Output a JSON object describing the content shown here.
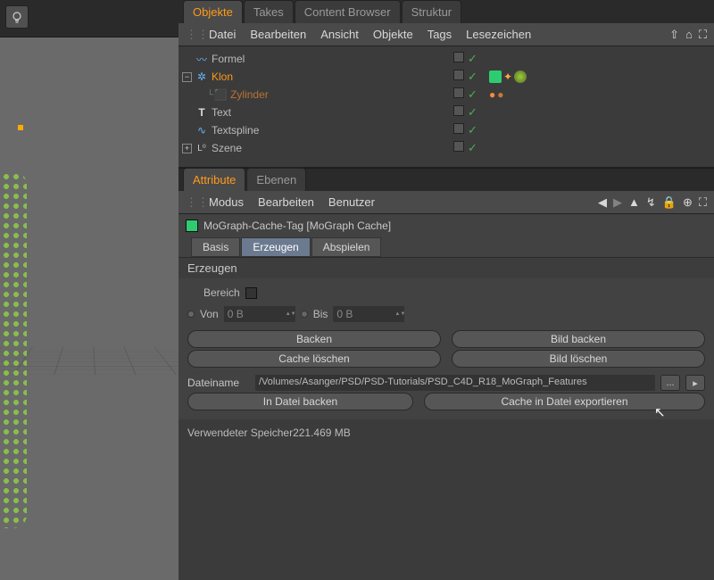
{
  "top_tabs": {
    "objekte": "Objekte",
    "takes": "Takes",
    "content": "Content Browser",
    "struktur": "Struktur"
  },
  "top_menu": {
    "datei": "Datei",
    "bearbeiten": "Bearbeiten",
    "ansicht": "Ansicht",
    "objekte": "Objekte",
    "tags": "Tags",
    "lesezeichen": "Lesezeichen"
  },
  "tree": {
    "formel": "Formel",
    "klon": "Klon",
    "zylinder": "Zylinder",
    "text": "Text",
    "textspline": "Textspline",
    "szene": "Szene"
  },
  "attr_tabs": {
    "attribute": "Attribute",
    "ebenen": "Ebenen"
  },
  "attr_menu": {
    "modus": "Modus",
    "bearbeiten": "Bearbeiten",
    "benutzer": "Benutzer"
  },
  "tag_title": "MoGraph-Cache-Tag [MoGraph Cache]",
  "subtabs": {
    "basis": "Basis",
    "erzeugen": "Erzeugen",
    "abspielen": "Abspielen"
  },
  "section": "Erzeugen",
  "fields": {
    "bereich": "Bereich",
    "von": "Von",
    "von_val": "0 B",
    "bis": "Bis",
    "bis_val": "0 B",
    "dateiname": "Dateiname",
    "path": "/Volumes/Asanger/PSD/PSD-Tutorials/PSD_C4D_R18_MoGraph_Features"
  },
  "buttons": {
    "backen": "Backen",
    "bild_backen": "Bild backen",
    "cache_loeschen": "Cache löschen",
    "bild_loeschen": "Bild löschen",
    "in_datei_backen": "In Datei backen",
    "export": "Cache in Datei exportieren",
    "browse": "...",
    "arrow": "▸"
  },
  "memory": {
    "label": "Verwendeter Speicher",
    "value": "221.469 MB"
  }
}
